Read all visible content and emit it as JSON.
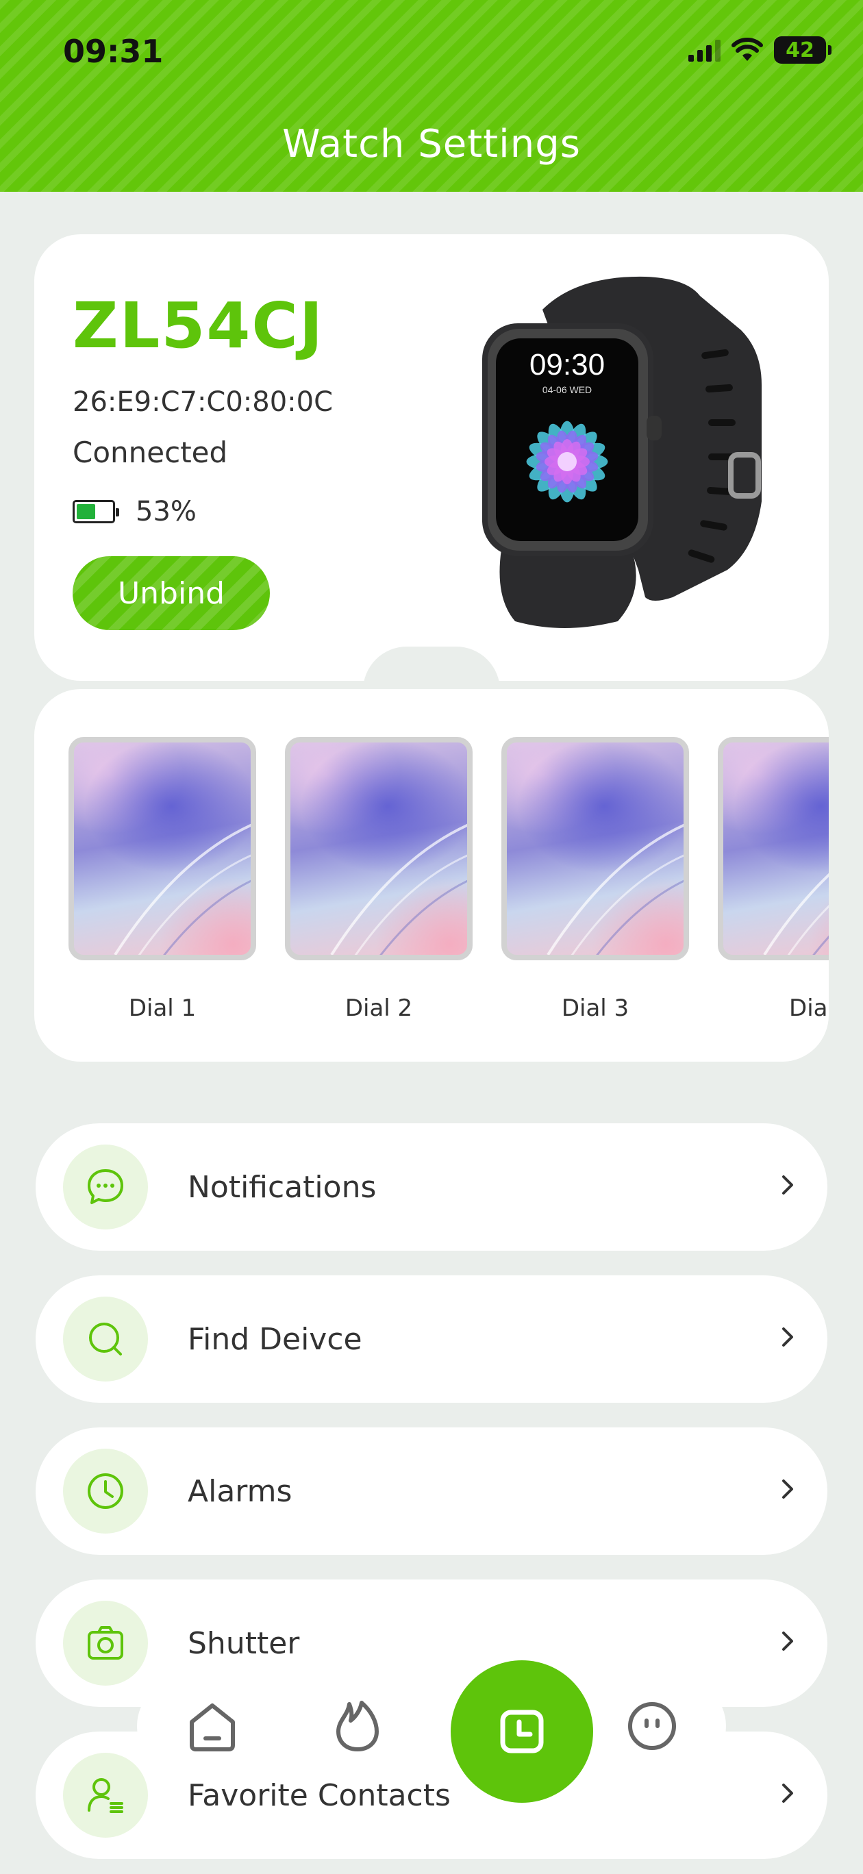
{
  "status_bar": {
    "time": "09:31",
    "battery": "42"
  },
  "header": {
    "title": "Watch Settings"
  },
  "device": {
    "name": "ZL54CJ",
    "mac": "26:E9:C7:C0:80:0C",
    "status": "Connected",
    "battery": "53%",
    "battery_level": 0.53,
    "unbind_label": "Unbind",
    "watch_time": "09:30",
    "watch_date": "04-06  WED"
  },
  "dials": [
    {
      "label": "Dial 1"
    },
    {
      "label": "Dial 2"
    },
    {
      "label": "Dial 3"
    },
    {
      "label": "Dial"
    }
  ],
  "menu": [
    {
      "label": "Notifications",
      "icon": "chat-bubble-icon"
    },
    {
      "label": "Find Deivce",
      "icon": "search-icon"
    },
    {
      "label": "Alarms",
      "icon": "clock-icon"
    },
    {
      "label": "Shutter",
      "icon": "camera-icon"
    },
    {
      "label": "Favorite Contacts",
      "icon": "contacts-icon"
    }
  ],
  "nav": {
    "items": [
      "home-icon",
      "flame-icon",
      "watch-icon",
      "profile-face-icon"
    ],
    "active": "watch-icon"
  },
  "colors": {
    "accent": "#5ec40b",
    "background": "#eaeeeb"
  }
}
